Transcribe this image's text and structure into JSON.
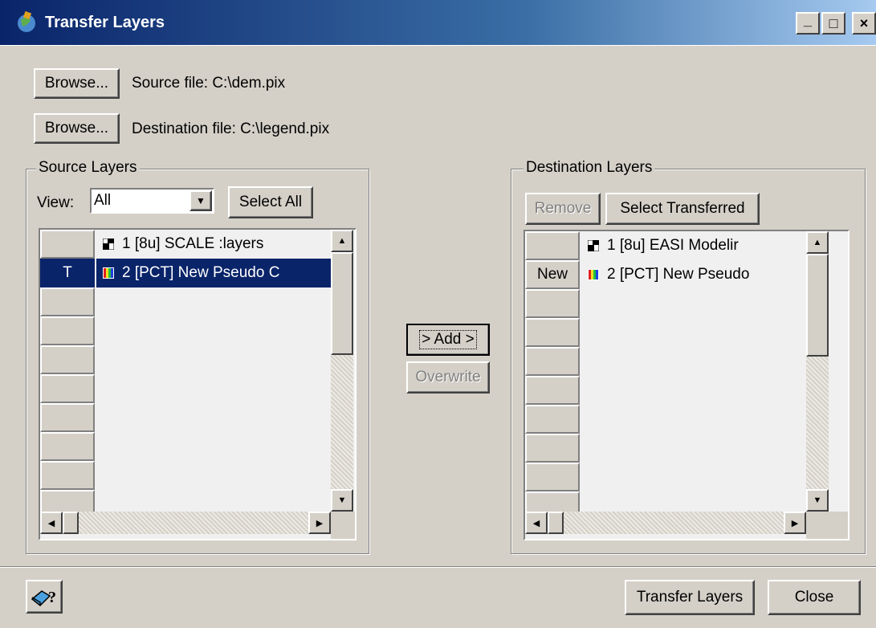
{
  "window": {
    "title": "Transfer Layers",
    "caption_buttons": {
      "minimize": "_",
      "maximize": "□",
      "close": "×"
    }
  },
  "files": {
    "browse_label": "Browse...",
    "source_label": "Source file: C:\\dem.pix",
    "destination_label": "Destination file: C:\\legend.pix"
  },
  "source_layers": {
    "title": "Source Layers",
    "view_label": "View:",
    "view_value": "All",
    "select_all": "Select All",
    "rows": [
      {
        "header": "",
        "icon": "grayscale-layer-icon",
        "text": "1    [8u]  SCALE  :layers",
        "selected": false
      },
      {
        "header": "T",
        "icon": "pct-layer-icon",
        "text": "2  [PCT]  New Pseudo C",
        "selected": true
      }
    ]
  },
  "middle": {
    "add": "> Add >",
    "overwrite": "Overwrite"
  },
  "destination_layers": {
    "title": "Destination Layers",
    "remove": "Remove",
    "select_transferred": "Select Transferred",
    "rows": [
      {
        "header": "",
        "icon": "grayscale-layer-icon",
        "text": "1    [8u]  EASI Modelir",
        "selected": false
      },
      {
        "header": "New",
        "icon": "pct-layer-icon",
        "text": "2  [PCT]  New Pseudo",
        "selected": false
      }
    ]
  },
  "footer": {
    "help_icon": "book-help-icon",
    "transfer": "Transfer Layers",
    "close": "Close"
  }
}
